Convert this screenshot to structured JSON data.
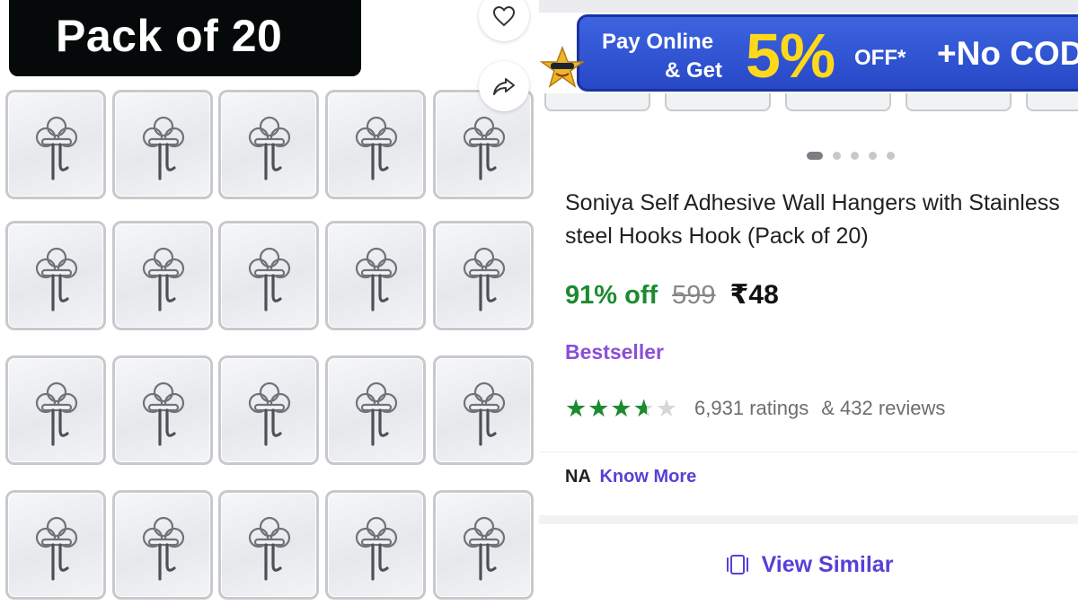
{
  "image_panel": {
    "pack_badge": "Pack of 20",
    "wishlist_icon": "heart-outline-icon",
    "share_icon": "share-arrow-icon"
  },
  "promo_banner": {
    "line1": "Pay Online",
    "line2": "& Get",
    "percent": "5%",
    "off": "OFF*",
    "cod": "+No COD F"
  },
  "carousel": {
    "total": 5,
    "active": 1
  },
  "product": {
    "title": "Soniya Self Adhesive Wall Hangers with Stainless steel Hooks Hook (Pack of 20)",
    "discount": "91% off",
    "mrp": "599",
    "price": "₹48",
    "badge": "Bestseller"
  },
  "rating": {
    "stars": 3.6,
    "ratings": "6,931 ratings",
    "reviews": "& 432 reviews"
  },
  "delivery": {
    "na_label": "NA",
    "know_more": "Know More"
  },
  "view_similar": "View Similar",
  "colors": {
    "green": "#1c8a2f",
    "purple": "#8a4fd8",
    "link": "#5a3fd6",
    "banner_blue": "#2748c7",
    "banner_yellow": "#ffd81b"
  }
}
